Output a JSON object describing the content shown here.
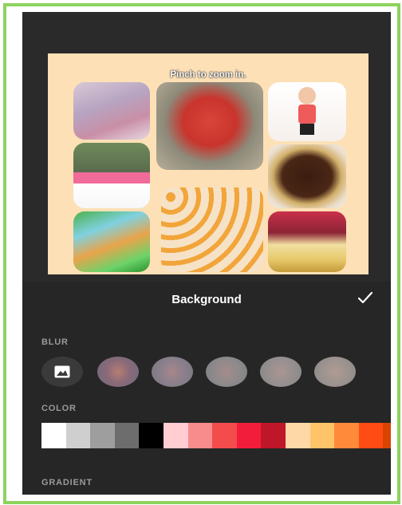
{
  "preview": {
    "hint": "Pinch to zoom in."
  },
  "panel": {
    "title": "Background",
    "confirm_icon": "checkmark-icon",
    "blur_label": "BLUR",
    "color_label": "COLOR",
    "gradient_label": "GRADIENT",
    "image_icon": "image-icon"
  },
  "colors": {
    "frame": "#8dd35f",
    "panel_bg": "#262626",
    "canvas_bg": "#fde0b6"
  },
  "swatches": [
    "#ffffff",
    "#cfcfcf",
    "#9e9e9e",
    "#6d6d6d",
    "#000000",
    "#ffcdd2",
    "#f88b8b",
    "#f44c4c",
    "#f21d3a",
    "#c0162a",
    "#ffd8a8",
    "#ffc46a",
    "#ff8a3a",
    "#ff4b14",
    "#d94400"
  ],
  "gradients": [
    "#e57ad9",
    "#5fe0d8",
    "#c8e65a",
    "#e8a37a",
    "#4d4de0",
    "#e04d6a"
  ]
}
